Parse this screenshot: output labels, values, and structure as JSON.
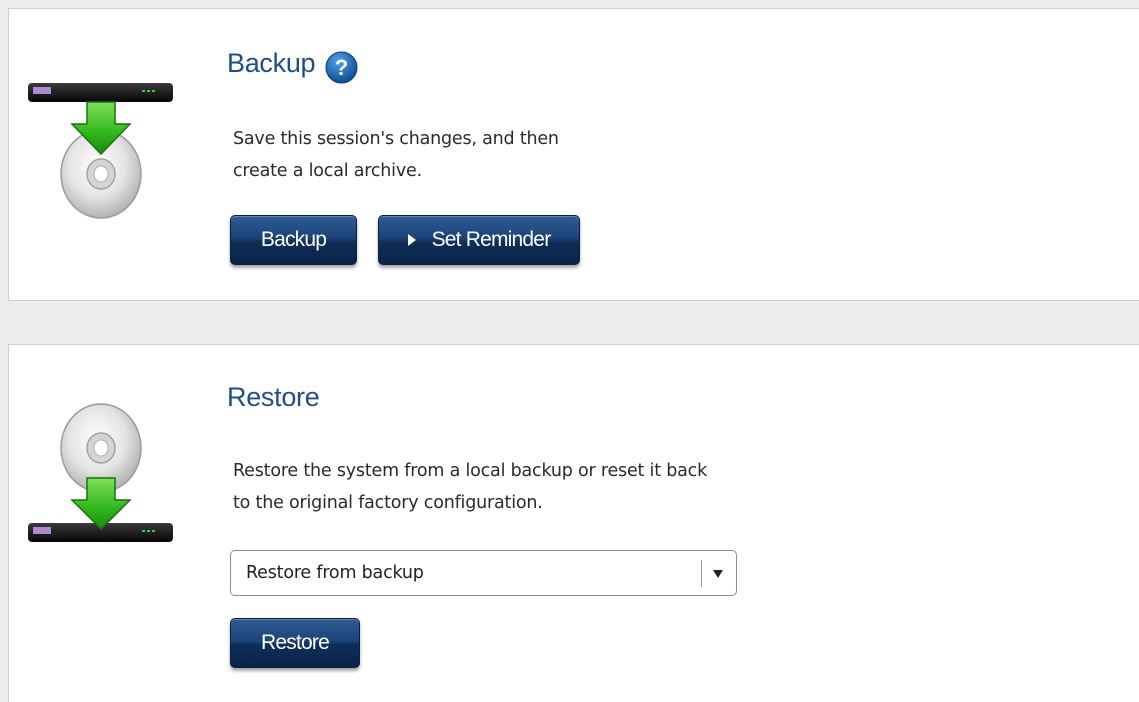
{
  "backup": {
    "title": "Backup",
    "help_icon": "help-icon",
    "description_line1": "Save this session's changes, and then",
    "description_line2": "create a local archive.",
    "backup_button_label": "Backup",
    "reminder_button_label": "Set Reminder",
    "illustration_icon": "device-to-disc-icon"
  },
  "restore": {
    "title": "Restore",
    "description_line1": "Restore the system from a local backup or reset it back",
    "description_line2": "to the original factory configuration.",
    "select_value": "Restore from backup",
    "restore_button_label": "Restore",
    "illustration_icon": "disc-to-device-icon"
  },
  "colors": {
    "title": "#1f4f86",
    "button": "#1b4479",
    "arrow": "#3fc12a"
  }
}
